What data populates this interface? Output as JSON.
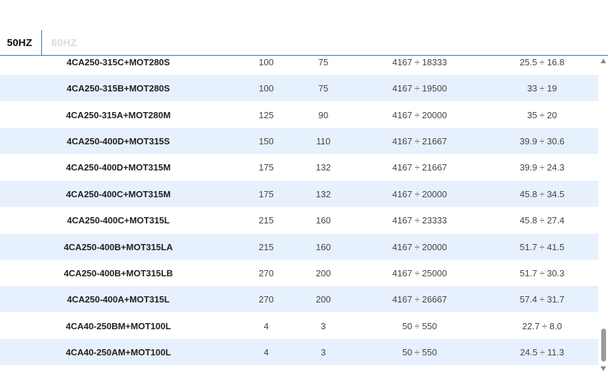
{
  "tabs": [
    {
      "label": "50HZ",
      "active": true
    },
    {
      "label": "60HZ",
      "active": false
    }
  ],
  "rows": [
    {
      "model": "4CA250-315C+MOT280S",
      "p1": "100",
      "p2": "75",
      "q": "4167 ÷ 18333",
      "h": "25.5 ÷ 16.8"
    },
    {
      "model": "4CA250-315B+MOT280S",
      "p1": "100",
      "p2": "75",
      "q": "4167 ÷ 19500",
      "h": "33 ÷ 19"
    },
    {
      "model": "4CA250-315A+MOT280M",
      "p1": "125",
      "p2": "90",
      "q": "4167 ÷ 20000",
      "h": "35 ÷ 20"
    },
    {
      "model": "4CA250-400D+MOT315S",
      "p1": "150",
      "p2": "110",
      "q": "4167 ÷ 21667",
      "h": "39.9 ÷ 30.6"
    },
    {
      "model": "4CA250-400D+MOT315M",
      "p1": "175",
      "p2": "132",
      "q": "4167 ÷ 21667",
      "h": "39.9 ÷ 24.3"
    },
    {
      "model": "4CA250-400C+MOT315M",
      "p1": "175",
      "p2": "132",
      "q": "4167 ÷ 20000",
      "h": "45.8 ÷ 34.5"
    },
    {
      "model": "4CA250-400C+MOT315L",
      "p1": "215",
      "p2": "160",
      "q": "4167 ÷ 23333",
      "h": "45.8 ÷ 27.4"
    },
    {
      "model": "4CA250-400B+MOT315LA",
      "p1": "215",
      "p2": "160",
      "q": "4167 ÷ 20000",
      "h": "51.7 ÷ 41.5"
    },
    {
      "model": "4CA250-400B+MOT315LB",
      "p1": "270",
      "p2": "200",
      "q": "4167 ÷ 25000",
      "h": "51.7 ÷ 30.3"
    },
    {
      "model": "4CA250-400A+MOT315L",
      "p1": "270",
      "p2": "200",
      "q": "4167 ÷ 26667",
      "h": "57.4 ÷ 31.7"
    },
    {
      "model": "4CA40-250BM+MOT100L",
      "p1": "4",
      "p2": "3",
      "q": "50 ÷ 550",
      "h": "22.7 ÷ 8.0"
    },
    {
      "model": "4CA40-250AM+MOT100L",
      "p1": "4",
      "p2": "3",
      "q": "50 ÷ 550",
      "h": "24.5 ÷ 11.3"
    }
  ],
  "colors": {
    "accent": "#2b6fb8",
    "row_alt": "#e7f1fd",
    "inactive_tab": "#d7dbe0"
  },
  "icons": {
    "scroll_up": "triangle-up-icon",
    "scroll_down": "triangle-down-icon"
  }
}
